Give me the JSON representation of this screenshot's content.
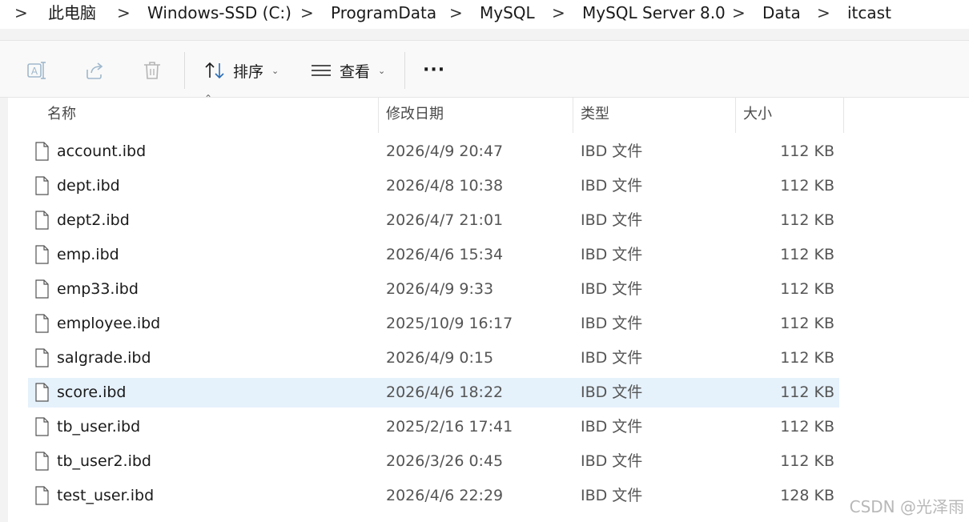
{
  "breadcrumb": {
    "items": [
      "此电脑",
      "Windows-SSD (C:)",
      "ProgramData",
      "MySQL",
      "MySQL Server 8.0",
      "Data",
      "itcast"
    ],
    "separator": ">"
  },
  "toolbar": {
    "sort_label": "排序",
    "view_label": "查看",
    "more_label": "···"
  },
  "columns": {
    "name": "名称",
    "modified": "修改日期",
    "type": "类型",
    "size": "大小"
  },
  "files": [
    {
      "name": "account.ibd",
      "modified": "2026/4/9 20:47",
      "type": "IBD 文件",
      "size": "112 KB"
    },
    {
      "name": "dept.ibd",
      "modified": "2026/4/8 10:38",
      "type": "IBD 文件",
      "size": "112 KB"
    },
    {
      "name": "dept2.ibd",
      "modified": "2026/4/7 21:01",
      "type": "IBD 文件",
      "size": "112 KB"
    },
    {
      "name": "emp.ibd",
      "modified": "2026/4/6 15:34",
      "type": "IBD 文件",
      "size": "112 KB"
    },
    {
      "name": "emp33.ibd",
      "modified": "2026/4/9 9:33",
      "type": "IBD 文件",
      "size": "112 KB"
    },
    {
      "name": "employee.ibd",
      "modified": "2025/10/9 16:17",
      "type": "IBD 文件",
      "size": "112 KB"
    },
    {
      "name": "salgrade.ibd",
      "modified": "2026/4/9 0:15",
      "type": "IBD 文件",
      "size": "112 KB"
    },
    {
      "name": "score.ibd",
      "modified": "2026/4/6 18:22",
      "type": "IBD 文件",
      "size": "112 KB"
    },
    {
      "name": "tb_user.ibd",
      "modified": "2025/2/16 17:41",
      "type": "IBD 文件",
      "size": "112 KB"
    },
    {
      "name": "tb_user2.ibd",
      "modified": "2026/3/26 0:45",
      "type": "IBD 文件",
      "size": "112 KB"
    },
    {
      "name": "test_user.ibd",
      "modified": "2026/4/6 22:29",
      "type": "IBD 文件",
      "size": "128 KB"
    }
  ],
  "selected_file": "score.ibd",
  "watermark": "CSDN @光泽雨",
  "colors": {
    "selection": "#e5f1fb",
    "toolbar_bg": "#f9f9f9"
  }
}
